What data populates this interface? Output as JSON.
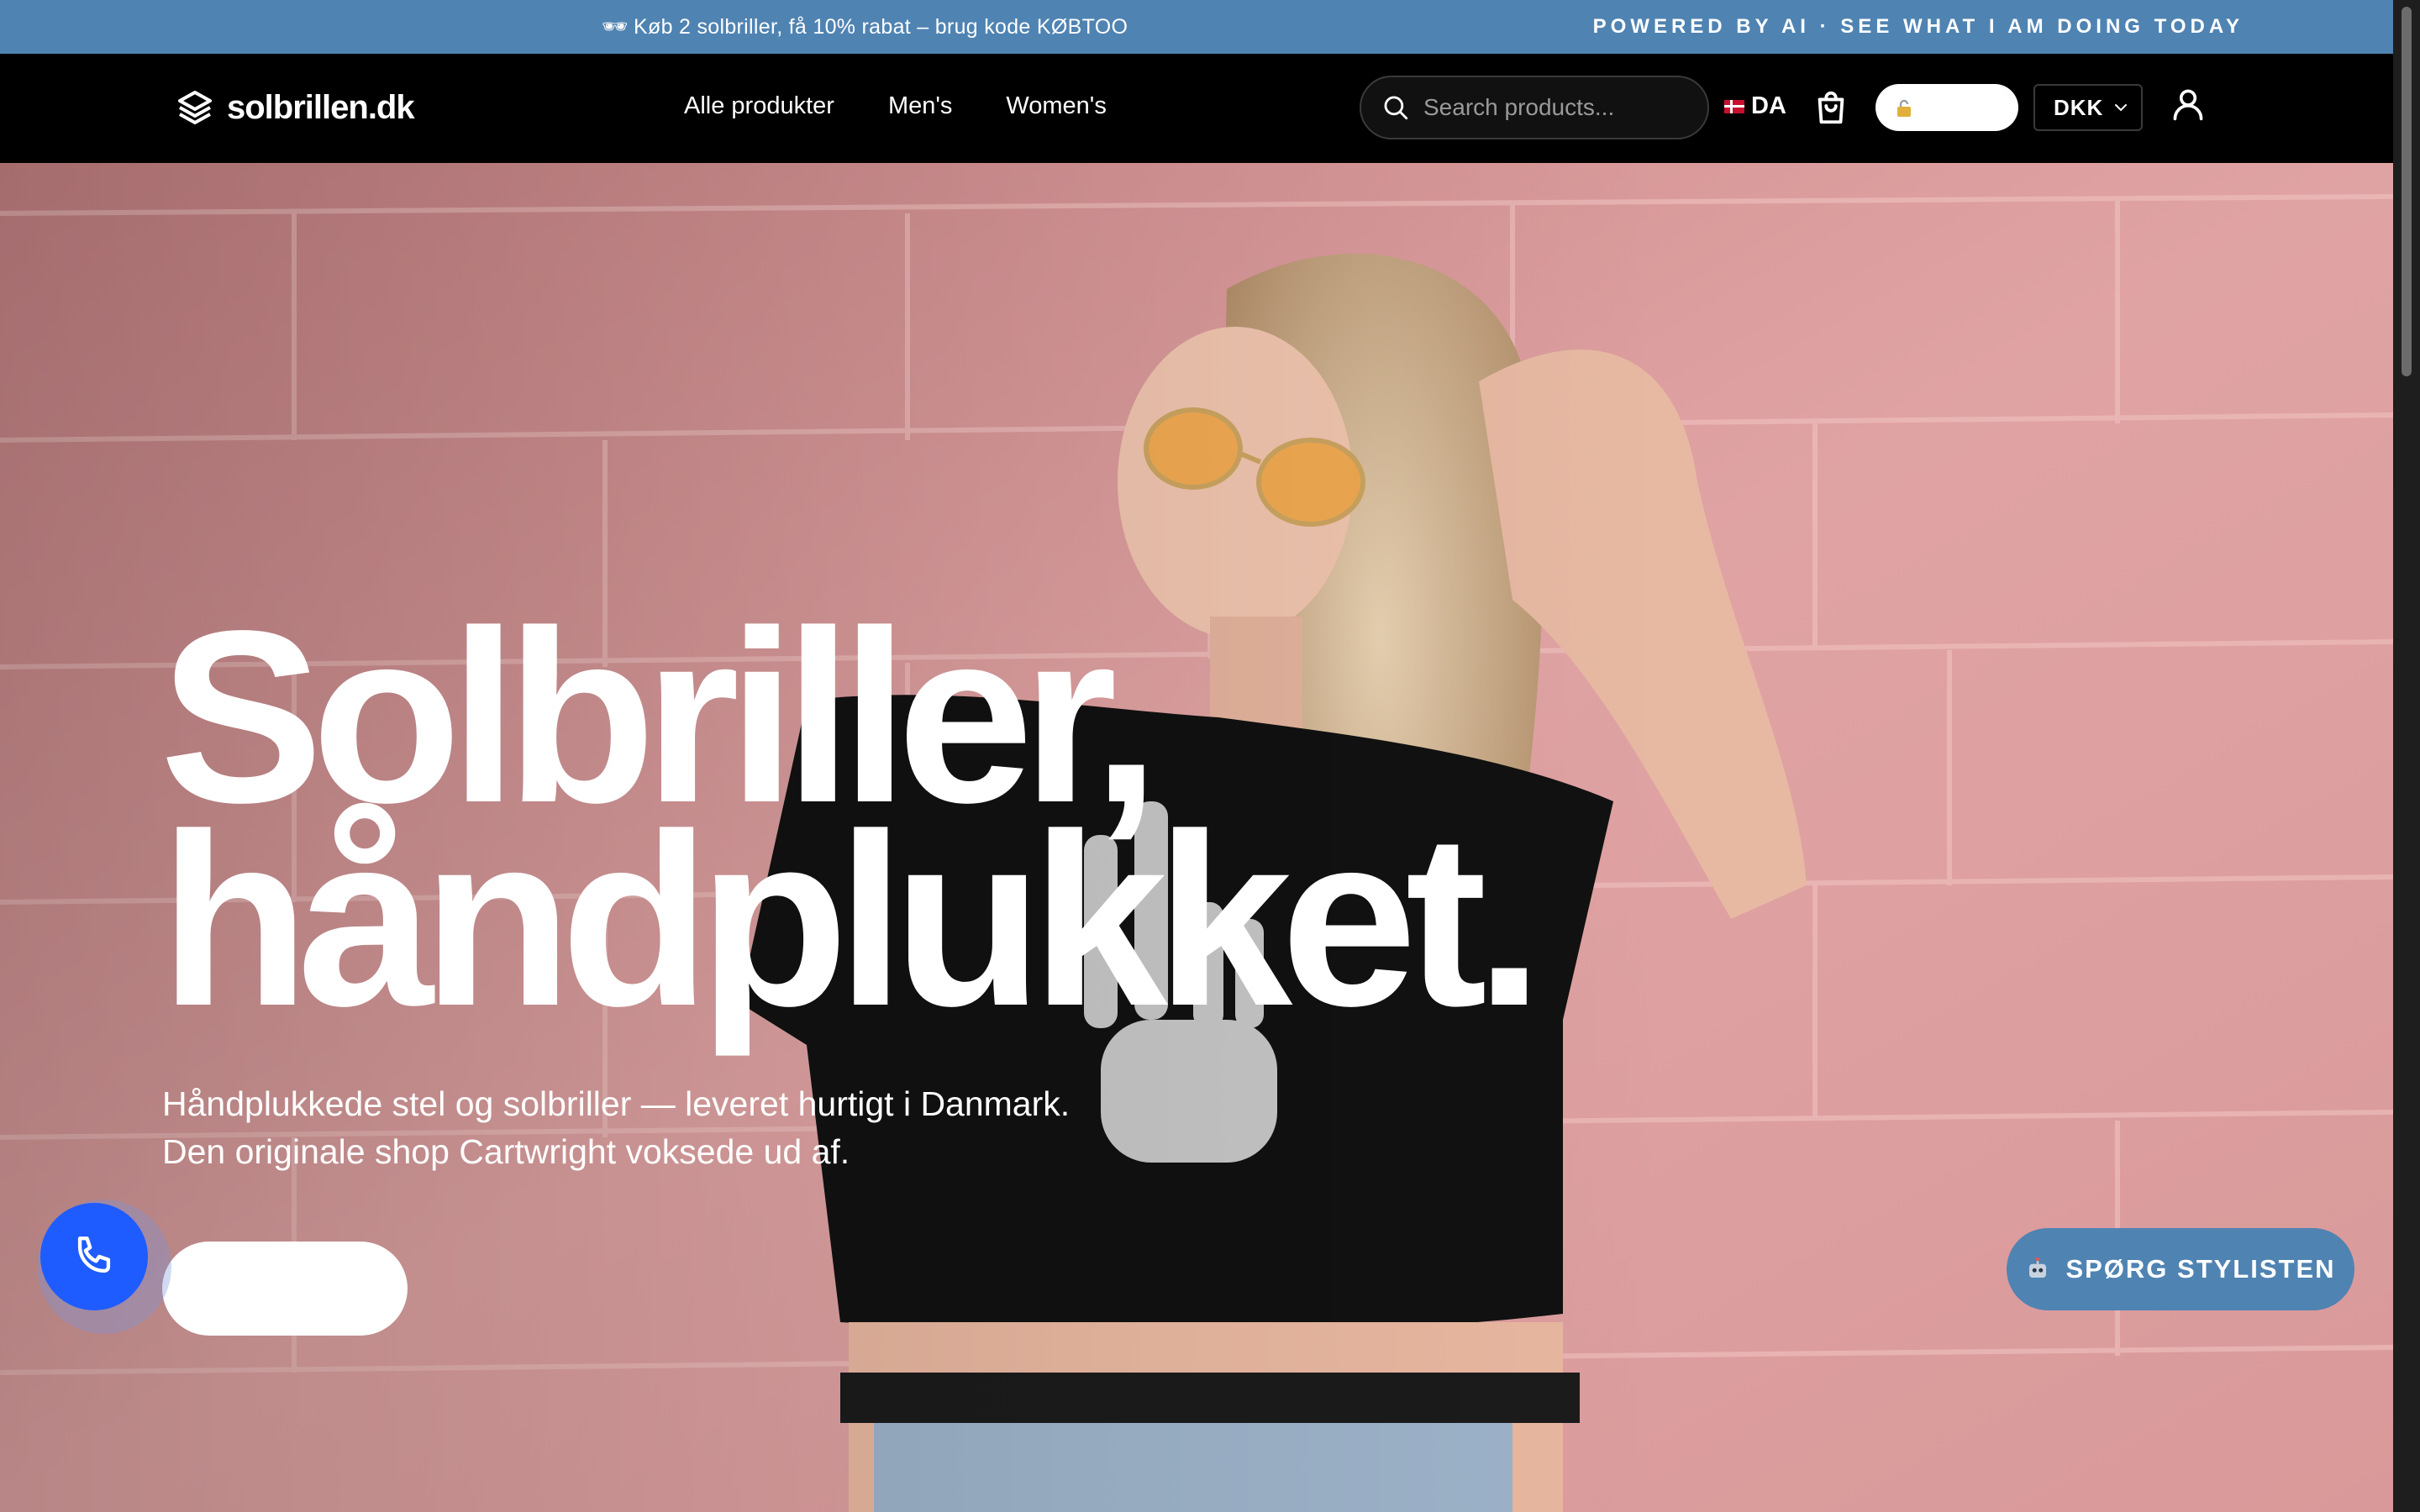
{
  "announcement": {
    "glasses_emoji": "🕶",
    "promo_text": "Køb 2 solbriller, få 10% rabat – brug kode KØBTOO",
    "ai_link": "POWERED BY AI · SEE WHAT I AM DOING TODAY"
  },
  "header": {
    "logo_text": "solbrillen.dk",
    "nav": [
      {
        "label": "Alle produkter"
      },
      {
        "label": "Men's"
      },
      {
        "label": "Women's"
      }
    ],
    "search": {
      "placeholder": "Search products...",
      "value": ""
    },
    "language": "DA",
    "currency": "DKK",
    "pill_button_label": ""
  },
  "hero": {
    "title_line1": "Solbriller,",
    "title_line2": "håndplukket.",
    "subtitle_line1": "Håndplukkede stel og solbriller — leveret hurtigt i Danmark.",
    "subtitle_line2": "Den originale shop Cartwright voksede ud af.",
    "cta_label": ""
  },
  "widgets": {
    "stylist_label": "SPØRG STYLISTEN"
  },
  "colors": {
    "announcement_bg": "#4f83b2",
    "header_bg": "#000000",
    "hero_wall": "#d9979b",
    "phone_button": "#1f5cff",
    "stylist_button": "#4f83b2"
  },
  "icons": [
    "layers-logo-icon",
    "search-icon",
    "denmark-flag-icon",
    "shopping-bag-icon",
    "lock-icon",
    "chevron-down-icon",
    "user-icon",
    "phone-icon",
    "robot-icon"
  ]
}
